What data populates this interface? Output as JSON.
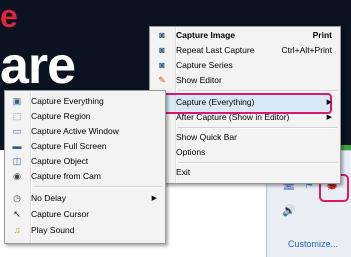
{
  "logo": {
    "line1": "e",
    "line2": "are"
  },
  "main_menu": {
    "items": [
      {
        "label": "Capture Image",
        "shortcut": "Print",
        "bold": true,
        "icon": "camera-icon"
      },
      {
        "label": "Repeat Last Capture",
        "shortcut": "Ctrl+Alt+Print",
        "icon": "repeat-camera-icon"
      },
      {
        "label": "Capture Series",
        "icon": "camera-series-icon"
      },
      {
        "label": "Show Editor",
        "icon": "editor-icon"
      },
      {
        "label": "Capture (Everything)",
        "icon": "capture-everything-icon",
        "submenu": true,
        "highlighted": true
      },
      {
        "label": "After Capture (Show in Editor)",
        "icon": "after-capture-icon",
        "submenu": true
      },
      {
        "label": "Show Quick Bar",
        "icon": "quick-bar-icon"
      },
      {
        "label": "Options",
        "icon": "options-icon"
      },
      {
        "label": "Exit"
      }
    ]
  },
  "sub_menu": {
    "items": [
      {
        "label": "Capture Everything",
        "icon": "capture-everything-icon"
      },
      {
        "label": "Capture Region",
        "icon": "region-icon"
      },
      {
        "label": "Capture Active Window",
        "icon": "window-icon"
      },
      {
        "label": "Capture Full Screen",
        "icon": "monitor-icon"
      },
      {
        "label": "Capture Object",
        "icon": "object-icon"
      },
      {
        "label": "Capture from Cam",
        "icon": "webcam-icon"
      },
      {
        "label": "No Delay",
        "icon": "clock-icon",
        "submenu": true
      },
      {
        "label": "Capture Cursor",
        "icon": "cursor-icon"
      },
      {
        "label": "Play Sound",
        "icon": "music-icon"
      }
    ]
  },
  "tray": {
    "customize": "Customize..."
  },
  "colors": {
    "highlight": "#d81b68",
    "logo_red": "#d9263a",
    "background_dark": "#0b1220"
  }
}
